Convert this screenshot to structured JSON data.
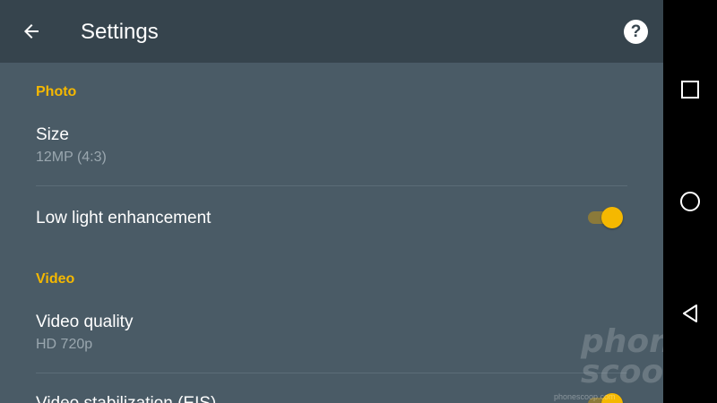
{
  "header": {
    "title": "Settings"
  },
  "icons": {
    "back": "arrow-left-icon",
    "help": "question-mark-icon"
  },
  "help_glyph": "?",
  "sections": {
    "photo": {
      "header": "Photo",
      "size": {
        "title": "Size",
        "value": "12MP (4:3)"
      },
      "low_light": {
        "title": "Low light enhancement",
        "enabled": true
      }
    },
    "video": {
      "header": "Video",
      "quality": {
        "title": "Video quality",
        "value": "HD 720p"
      },
      "stabilization": {
        "title": "Video stabilization (EIS)",
        "enabled": true
      }
    }
  },
  "watermark": {
    "brand_line1": "phone",
    "brand_line2": "scoop",
    "url": "phonescoop.com"
  },
  "colors": {
    "accent": "#f5b800",
    "appbar": "#36444d",
    "background": "#4a5b66",
    "subtext": "#9aa7af"
  },
  "navbar": {
    "recents": "square-icon",
    "home": "circle-icon",
    "back": "triangle-back-icon"
  }
}
